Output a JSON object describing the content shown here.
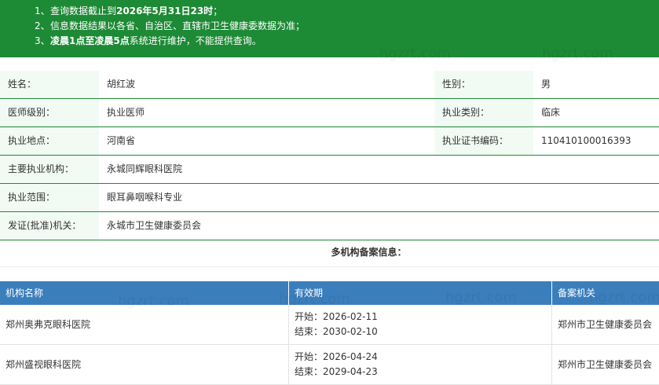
{
  "notice": {
    "line1": {
      "num": "1、",
      "pre": "查询数据截止到",
      "strong": "2026年5月31日23时",
      "post": "；"
    },
    "line2": {
      "num": "2、",
      "pre": "信息数据结果以各省、自治区、直辖市卫生健康委数据为准；"
    },
    "line3": {
      "num": "3、",
      "strong": "凌晨1点至凌晨5点",
      "post": "系统进行维护，不能提供查询。"
    }
  },
  "info": {
    "name_label": "姓名：",
    "name": "胡红波",
    "gender_label": "性别：",
    "gender": "男",
    "level_label": "医师级别：",
    "level": "执业医师",
    "category_label": "执业类别：",
    "category": "临床",
    "place_label": "执业地点：",
    "place": "河南省",
    "cert_label": "执业证书编码：",
    "cert": "110410100016393",
    "org_label": "主要执业机构：",
    "org": "永城同辉眼科医院",
    "scope_label": "执业范围：",
    "scope": "眼耳鼻咽喉科专业",
    "issuer_label": "发证(批准)机关：",
    "issuer": "永城市卫生健康委员会"
  },
  "multi_title": "多机构备案信息：",
  "table": {
    "headers": [
      "机构名称",
      "有效期",
      "备案机关"
    ],
    "rows": [
      {
        "name": "郑州奥弗克眼科医院",
        "start": "开始：2026-02-11",
        "end": "结束：2030-02-10",
        "authority": "郑州市卫生健康委员会"
      },
      {
        "name": "郑州盛视眼科医院",
        "start": "开始：2026-04-24",
        "end": "结束：2029-04-23",
        "authority": "郑州市卫生健康委员会"
      }
    ]
  },
  "watermark": "hgzrt.com"
}
